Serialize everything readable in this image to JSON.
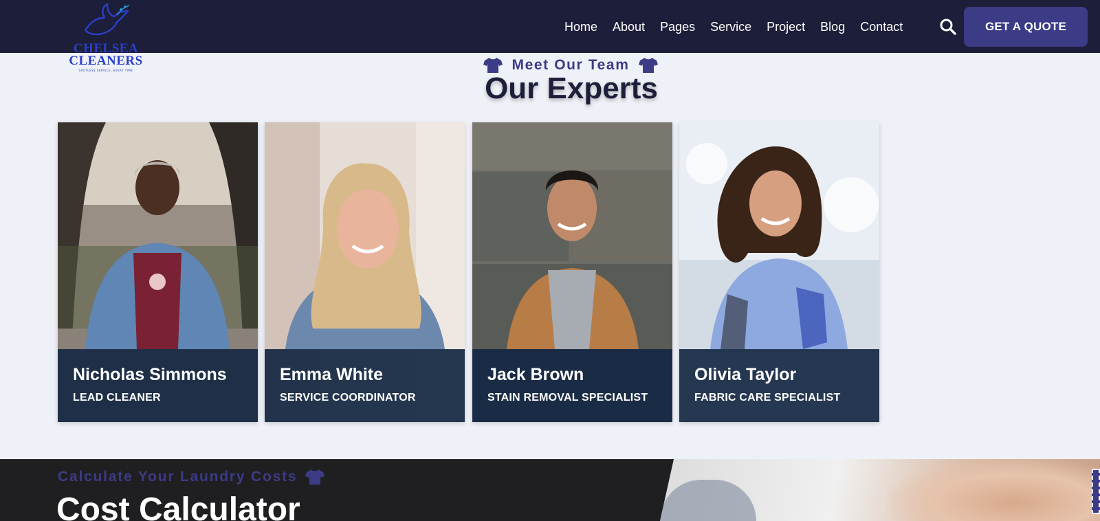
{
  "brand": {
    "logo_line1": "CHELSEA",
    "logo_line2": "CLEANERS",
    "tagline": "SPOTLESS SERVICE, EVERY TIME",
    "accent": "#3c3b86",
    "header_bg": "#1d1e39"
  },
  "nav": {
    "items": [
      {
        "label": "Home"
      },
      {
        "label": "About"
      },
      {
        "label": "Pages"
      },
      {
        "label": "Service"
      },
      {
        "label": "Project"
      },
      {
        "label": "Blog"
      },
      {
        "label": "Contact"
      }
    ],
    "search_icon": "search-icon",
    "cta_label": "GET A QUOTE"
  },
  "team_section": {
    "eyebrow": "Meet Our Team",
    "eyebrow_icon": "tshirt-icon",
    "title": "Our Experts",
    "members": [
      {
        "name": "Nicholas Simmons",
        "role": "LEAD CLEANER"
      },
      {
        "name": "Emma White",
        "role": "SERVICE COORDINATOR"
      },
      {
        "name": "Jack Brown",
        "role": "STAIN REMOVAL SPECIALIST"
      },
      {
        "name": "Olivia Taylor",
        "role": "FABRIC CARE SPECIALIST"
      }
    ]
  },
  "calculator_section": {
    "eyebrow": "Calculate Your Laundry Costs",
    "title": "Cost Calculator"
  }
}
